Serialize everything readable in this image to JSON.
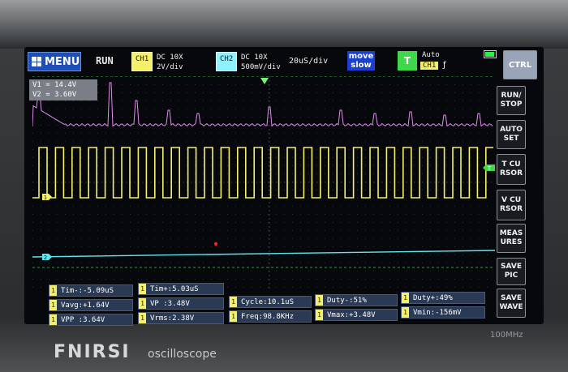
{
  "header": {
    "menu_label": "MENU",
    "run_state": "RUN",
    "ch1": {
      "badge": "CH1",
      "coupling": "DC 10X",
      "scale": "2V/div"
    },
    "ch2": {
      "badge": "CH2",
      "coupling": "DC 10X",
      "scale": "500mV/div"
    },
    "timebase": "20uS/div",
    "move_label_1": "move",
    "move_label_2": "slow",
    "trigger": {
      "badge": "T",
      "mode": "Auto",
      "source": "CH1",
      "edge": "ƒ"
    }
  },
  "cursor_readout": {
    "v1": "V1 = 14.4V",
    "v2": "V2 = 3.60V"
  },
  "markers": {
    "ch1": "1",
    "ch2": "2",
    "trigger_level": "T"
  },
  "side_buttons": [
    {
      "id": "ctrl",
      "line1": "CTRL",
      "line2": ""
    },
    {
      "id": "run-stop",
      "line1": "RUN/",
      "line2": "STOP"
    },
    {
      "id": "auto-set",
      "line1": "AUTO",
      "line2": "SET"
    },
    {
      "id": "t-cursor",
      "line1": "T CU",
      "line2": "RSOR"
    },
    {
      "id": "v-cursor",
      "line1": "V CU",
      "line2": "RSOR"
    },
    {
      "id": "measures",
      "line1": "MEAS",
      "line2": "URES"
    },
    {
      "id": "save-pic",
      "line1": "SAVE",
      "line2": "PIC"
    },
    {
      "id": "save-wave",
      "line1": "SAVE",
      "line2": "WAVE"
    }
  ],
  "measurements": [
    {
      "ch": "1",
      "text": "Tim-:-5.09uS"
    },
    {
      "ch": "1",
      "text": "Tim+:5.03uS"
    },
    {
      "ch": "1",
      "text": "Vavg:+1.64V"
    },
    {
      "ch": "1",
      "text": "VP  :3.48V"
    },
    {
      "ch": "1",
      "text": "Cycle:10.1uS"
    },
    {
      "ch": "1",
      "text": "Duty-:51%"
    },
    {
      "ch": "1",
      "text": "Duty+:49%"
    },
    {
      "ch": "1",
      "text": "VPP :3.64V"
    },
    {
      "ch": "1",
      "text": "Vrms:2.38V"
    },
    {
      "ch": "1",
      "text": "Freq:98.8KHz"
    },
    {
      "ch": "1",
      "text": "Vmax:+3.48V"
    },
    {
      "ch": "1",
      "text": "Vmin:-156mV"
    }
  ],
  "device": {
    "brand": "FNIRSI",
    "model": "oscilloscope",
    "spec": "100MHz"
  },
  "colors": {
    "ch1": "#f5f06a",
    "ch2": "#5fe7ee",
    "math": "#e58bf0",
    "menu": "#1d4fb8",
    "trigger": "#3ed84a"
  }
}
